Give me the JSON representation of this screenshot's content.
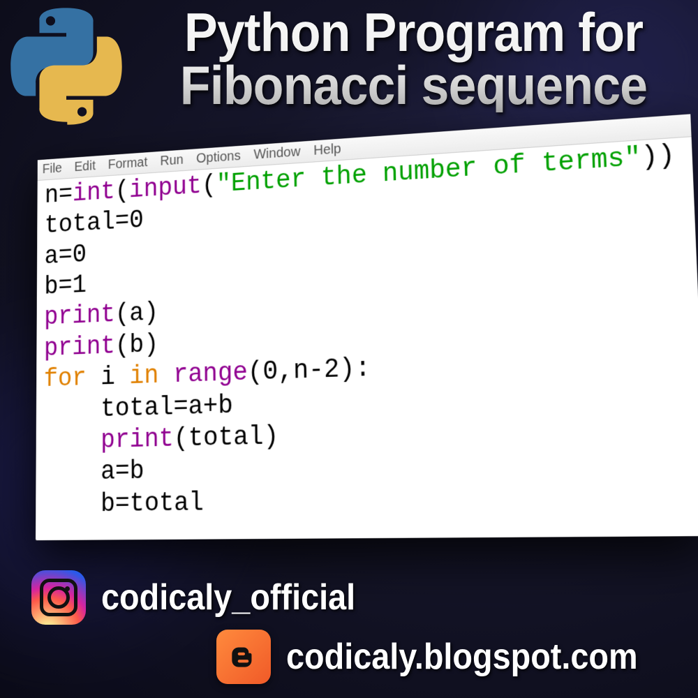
{
  "title_line1": "Python Program for",
  "title_line2": "Fibonacci sequence",
  "menu": {
    "file": "File",
    "edit": "Edit",
    "format": "Format",
    "run": "Run",
    "options": "Options",
    "window": "Window",
    "help": "Help"
  },
  "code": {
    "l1_a": "n=",
    "l1_b": "int",
    "l1_c": "(",
    "l1_d": "input",
    "l1_e": "(",
    "l1_f": "\"Enter the number of terms\"",
    "l1_g": "))",
    "l2": "total=0",
    "l3": "a=0",
    "l4": "b=1",
    "l5_a": "print",
    "l5_b": "(a)",
    "l6_a": "print",
    "l6_b": "(b)",
    "l7_a": "for",
    "l7_b": " i ",
    "l7_c": "in",
    "l7_d": " ",
    "l7_e": "range",
    "l7_f": "(0,n-2):",
    "l8": "    total=a+b",
    "l9_a": "    ",
    "l9_b": "print",
    "l9_c": "(total)",
    "l10": "    a=b",
    "l11": "    b=total"
  },
  "social": {
    "instagram_handle": "codicaly_official",
    "blog_url": "codicaly.blogspot.com"
  }
}
